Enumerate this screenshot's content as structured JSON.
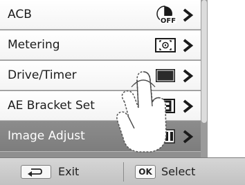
{
  "menu": {
    "items": [
      {
        "label": "ACB",
        "icon": "acb-off-icon",
        "selected": false
      },
      {
        "label": "Metering",
        "icon": "metering-icon",
        "selected": false
      },
      {
        "label": "Drive/Timer",
        "icon": "drive-single-icon",
        "selected": false
      },
      {
        "label": "AE Bracket Set",
        "icon": "ae-bracket-icon",
        "selected": false
      },
      {
        "label": "Image Adjust",
        "icon": "image-adjust-icon",
        "selected": true
      }
    ],
    "acb_icon_text": "OFF"
  },
  "bottom_bar": {
    "exit_label": "Exit",
    "ok_key": "OK",
    "select_label": "Select"
  },
  "colors": {
    "selected_row": "#868686",
    "row": "#ffffff",
    "bar": "#cbcbcb"
  }
}
